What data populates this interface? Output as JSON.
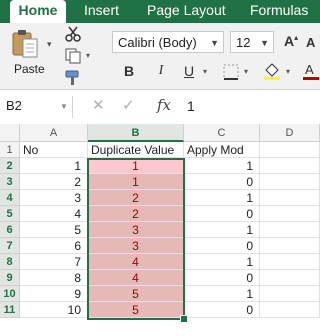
{
  "tabs": [
    {
      "label": "Home",
      "active": true
    },
    {
      "label": "Insert",
      "active": false
    },
    {
      "label": "Page Layout",
      "active": false
    },
    {
      "label": "Formulas",
      "active": false
    }
  ],
  "ribbon": {
    "paste_label": "Paste",
    "font_name": "Calibri (Body)",
    "font_size": "12",
    "bold_label": "B",
    "italic_label": "I",
    "underline_label": "U"
  },
  "formula_bar": {
    "name_box": "B2",
    "fx_label": "fx",
    "value": "1"
  },
  "columns": [
    "A",
    "B",
    "C",
    "D"
  ],
  "selected_column": "B",
  "rows": [
    {
      "num": "1",
      "a": "No",
      "b": "Duplicate Value",
      "c": "Apply Mod"
    },
    {
      "num": "2",
      "a": "1",
      "b": "1",
      "c": "1"
    },
    {
      "num": "3",
      "a": "2",
      "b": "1",
      "c": "0"
    },
    {
      "num": "4",
      "a": "3",
      "b": "2",
      "c": "1"
    },
    {
      "num": "5",
      "a": "4",
      "b": "2",
      "c": "0"
    },
    {
      "num": "6",
      "a": "5",
      "b": "3",
      "c": "1"
    },
    {
      "num": "7",
      "a": "6",
      "b": "3",
      "c": "0"
    },
    {
      "num": "8",
      "a": "7",
      "b": "4",
      "c": "1"
    },
    {
      "num": "9",
      "a": "8",
      "b": "4",
      "c": "0"
    },
    {
      "num": "10",
      "a": "9",
      "b": "5",
      "c": "1"
    },
    {
      "num": "11",
      "a": "10",
      "b": "5",
      "c": "0"
    }
  ],
  "colors": {
    "excel_green": "#1f7245",
    "dup_fill": "#e6b8b7",
    "dup_text": "#9c0006"
  }
}
